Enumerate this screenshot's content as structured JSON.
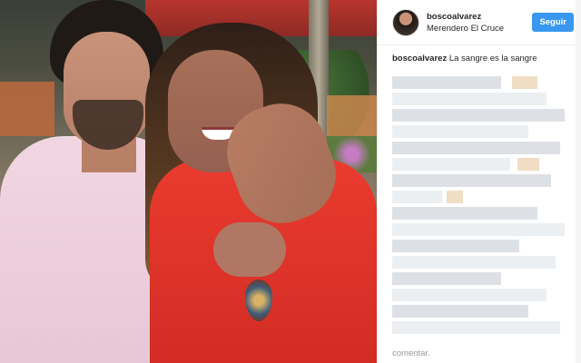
{
  "header": {
    "username": "boscoalvarez",
    "location": "Merendero El Cruce",
    "follow_label": "Seguir"
  },
  "caption": {
    "user": "boscoalvarez",
    "text": "La sangre es la sangre"
  },
  "comment": {
    "placeholder": "comentar."
  },
  "colors": {
    "accent": "#3897f0",
    "text": "#262626",
    "muted": "#999999"
  }
}
